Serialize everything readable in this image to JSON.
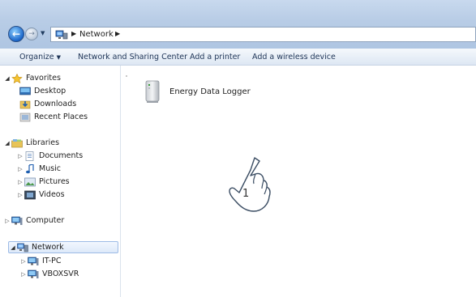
{
  "address_bar": {
    "back_icon": "back-arrow-icon",
    "forward_icon": "forward-arrow-icon",
    "location_icon": "network-icon",
    "path": [
      "Network"
    ]
  },
  "toolbar": {
    "organize_label": "Organize",
    "sharing_label": "Network and Sharing Center",
    "printer_label": "Add a printer",
    "wireless_label": "Add a wireless device"
  },
  "nav": {
    "favorites": {
      "label": "Favorites",
      "items": [
        {
          "label": "Desktop",
          "icon": "desktop-icon"
        },
        {
          "label": "Downloads",
          "icon": "downloads-icon"
        },
        {
          "label": "Recent Places",
          "icon": "recent-places-icon"
        }
      ]
    },
    "libraries": {
      "label": "Libraries",
      "items": [
        {
          "label": "Documents",
          "icon": "documents-icon"
        },
        {
          "label": "Music",
          "icon": "music-icon"
        },
        {
          "label": "Pictures",
          "icon": "pictures-icon"
        },
        {
          "label": "Videos",
          "icon": "videos-icon"
        }
      ]
    },
    "computer": {
      "label": "Computer",
      "icon": "computer-icon"
    },
    "network": {
      "label": "Network",
      "selected": true,
      "items": [
        {
          "label": "IT-PC",
          "icon": "computer-icon"
        },
        {
          "label": "VBOXSVR",
          "icon": "computer-icon"
        }
      ]
    }
  },
  "content": {
    "devices": [
      {
        "label": "Energy Data Logger",
        "icon": "data-logger-device-icon"
      }
    ],
    "annotation": {
      "step_number": "1",
      "icon": "pointing-hand-icon"
    }
  },
  "colors": {
    "chrome": "#b9cde6",
    "selection_border": "#9dbbe6",
    "link_text": "#1e3456"
  }
}
